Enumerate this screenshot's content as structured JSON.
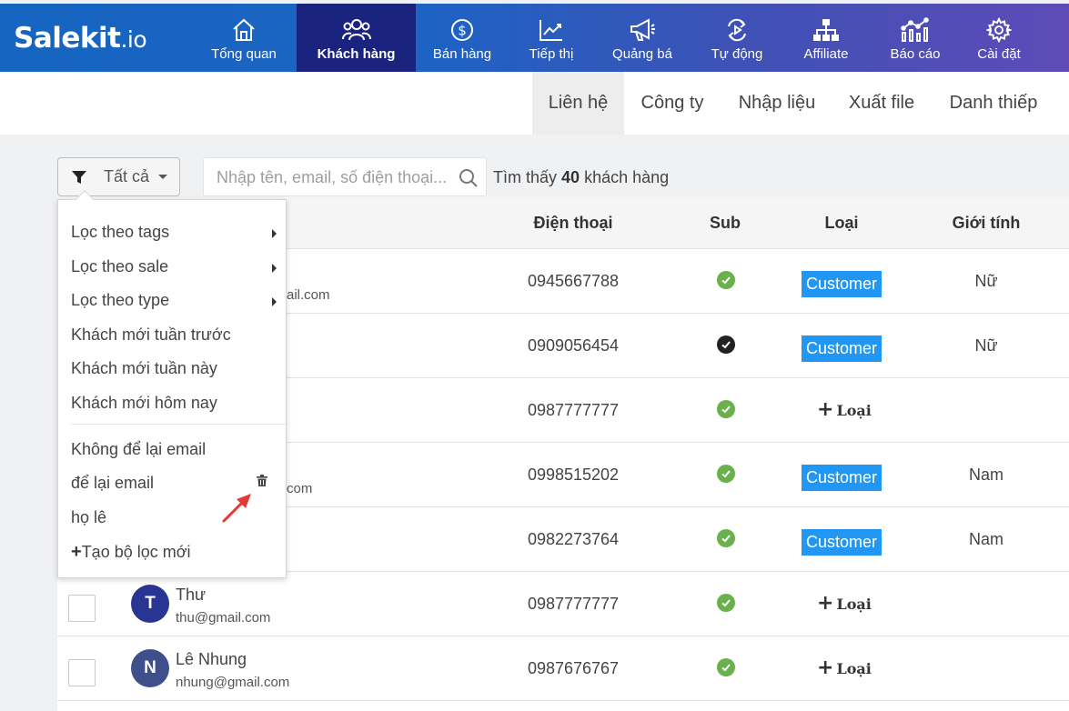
{
  "brand": {
    "name": "Salekit",
    "suffix": ".io"
  },
  "nav": {
    "items": [
      {
        "label": "Tổng quan",
        "icon": "home-icon"
      },
      {
        "label": "Khách hàng",
        "icon": "users-icon",
        "active": true
      },
      {
        "label": "Bán hàng",
        "icon": "dollar-icon"
      },
      {
        "label": "Tiếp thị",
        "icon": "chart-line-icon"
      },
      {
        "label": "Quảng bá",
        "icon": "megaphone-icon"
      },
      {
        "label": "Tự động",
        "icon": "automation-icon"
      },
      {
        "label": "Affiliate",
        "icon": "sitemap-icon"
      },
      {
        "label": "Báo cáo",
        "icon": "report-chart-icon"
      },
      {
        "label": "Cài đặt",
        "icon": "gear-icon"
      }
    ]
  },
  "subnav": {
    "tabs": [
      {
        "label": "Liên hệ",
        "active": true
      },
      {
        "label": "Công ty"
      },
      {
        "label": "Nhập liệu"
      },
      {
        "label": "Xuất file"
      },
      {
        "label": "Danh thiếp"
      }
    ]
  },
  "toolbar": {
    "filter_label": "Tất cả",
    "search_placeholder": "Nhập tên, email, số điện thoại...",
    "found_prefix": "Tìm thấy",
    "found_count": "40",
    "found_suffix": "khách hàng"
  },
  "table": {
    "headers": {
      "phone": "Điện thoại",
      "sub": "Sub",
      "type": "Loại",
      "gender": "Giới tính"
    },
    "rows": [
      {
        "email_partial": "ail.com",
        "phone": "0945667788",
        "sub": "green",
        "type": "Customer",
        "gender": "Nữ"
      },
      {
        "phone": "0909056454",
        "sub": "dark",
        "type": "Customer",
        "gender": "Nữ"
      },
      {
        "phone": "0987777777",
        "sub": "green",
        "type_action": "Loại",
        "gender": ""
      },
      {
        "email_partial": "com",
        "phone": "0998515202",
        "sub": "green",
        "type": "Customer",
        "gender": "Nam"
      },
      {
        "phone": "0982273764",
        "sub": "green",
        "type": "Customer",
        "gender": "Nam"
      },
      {
        "avatar": "T",
        "name": "Thư",
        "email": "thu@gmail.com",
        "phone": "0987777777",
        "sub": "green",
        "type_action": "Loại",
        "gender": ""
      },
      {
        "avatar": "N",
        "name": "Lê Nhung",
        "email": "nhung@gmail.com",
        "phone": "0987676767",
        "sub": "green",
        "type_action": "Loại",
        "gender": ""
      }
    ]
  },
  "filter_menu": {
    "items": [
      {
        "label": "Lọc theo tags",
        "submenu": true
      },
      {
        "label": "Lọc theo sale",
        "submenu": true
      },
      {
        "label": "Lọc theo type",
        "submenu": true
      },
      {
        "label": "Khách mới tuần trước"
      },
      {
        "label": "Khách mới tuần này"
      },
      {
        "label": "Khách mới hôm nay"
      }
    ],
    "saved": [
      {
        "label": "Không để lại email"
      },
      {
        "label": "để lại email",
        "icon": "trash-icon"
      },
      {
        "label": "họ lê"
      }
    ],
    "create_label": "Tạo bộ lọc mới"
  },
  "colors": {
    "nav_gradient_start": "#1565c0",
    "nav_gradient_end": "#5e4bb8",
    "nav_active": "#1a237e",
    "badge": "#2196f3",
    "sub_green": "#6ab04c",
    "sub_dark": "#222222",
    "avatar_t": "#283593",
    "avatar_n": "#3f4f8c",
    "annotation_arrow": "#e53935"
  }
}
